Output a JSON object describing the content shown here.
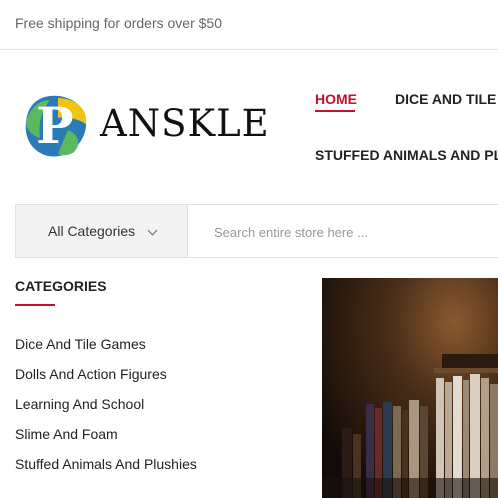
{
  "topbar": {
    "shipping_text": "Free shipping for orders over $50"
  },
  "logo": {
    "initial": "P",
    "wordmark": "ANSKLE",
    "colors": {
      "blue": "#2b7bb9",
      "yellow": "#f1c40f",
      "green": "#5cb85c",
      "letter": "#ffffff"
    }
  },
  "nav": {
    "items": [
      {
        "label": "HOME",
        "active": true
      },
      {
        "label": "DICE AND TILE G"
      },
      {
        "label": "STUFFED ANIMALS AND PLU"
      }
    ],
    "accent_color": "#c8102e"
  },
  "search": {
    "category_label": "All Categories",
    "placeholder": "Search entire store here ...",
    "value": ""
  },
  "sidebar": {
    "title": "CATEGORIES",
    "items": [
      {
        "label": "Dice And Tile Games"
      },
      {
        "label": "Dolls And Action Figures"
      },
      {
        "label": "Learning And School"
      },
      {
        "label": "Slime And Foam"
      },
      {
        "label": "Stuffed Animals And Plushies"
      }
    ]
  },
  "banner": {
    "description": "bookshelf-photo"
  }
}
